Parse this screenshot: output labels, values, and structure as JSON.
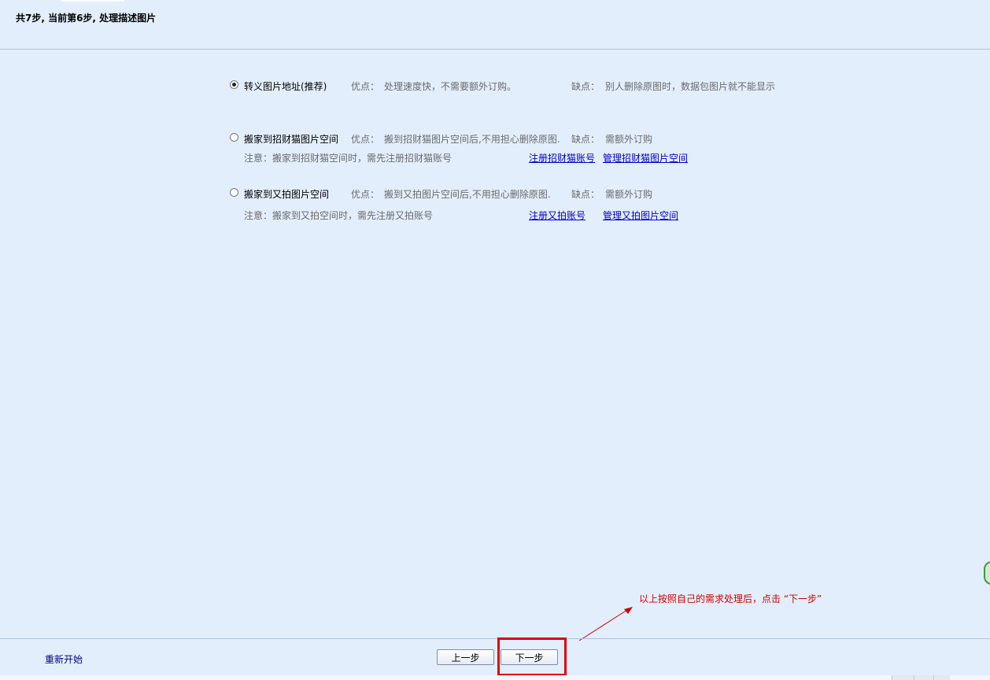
{
  "header": {
    "title": "共7步, 当前第6步, 处理描述图片"
  },
  "options": [
    {
      "label": "转义图片地址(推荐)",
      "checked": true,
      "pros_label": "优点：",
      "pros": "处理速度快，不需要额外订购。",
      "cons_label": "缺点：",
      "cons": "别人删除原图时，数据包图片就不能显示"
    },
    {
      "label": "搬家到招财猫图片空间",
      "checked": false,
      "pros_label": "优点：",
      "pros": "搬到招财猫图片空间后,不用担心删除原图.",
      "cons_label": "缺点：",
      "cons": "需额外订购",
      "note": "注意：搬家到招财猫空间时，需先注册招财猫账号",
      "link_register": "注册招财猫账号",
      "link_manage": "管理招财猫图片空间"
    },
    {
      "label": "搬家到又拍图片空间",
      "checked": false,
      "pros_label": "优点：",
      "pros": "搬到又拍图片空间后,不用担心删除原图.",
      "cons_label": "缺点：",
      "cons": "需额外订购",
      "note": "注意：搬家到又拍空间时，需先注册又拍账号",
      "link_register": "注册又拍账号",
      "link_manage": "管理又拍图片空间"
    }
  ],
  "footer": {
    "restart_label": "重新开始",
    "prev_label": "上一步",
    "next_label": "下一步"
  },
  "annotation": {
    "text": "以上按照自己的需求处理后，点击 “下一步”",
    "color": "#d00000"
  }
}
